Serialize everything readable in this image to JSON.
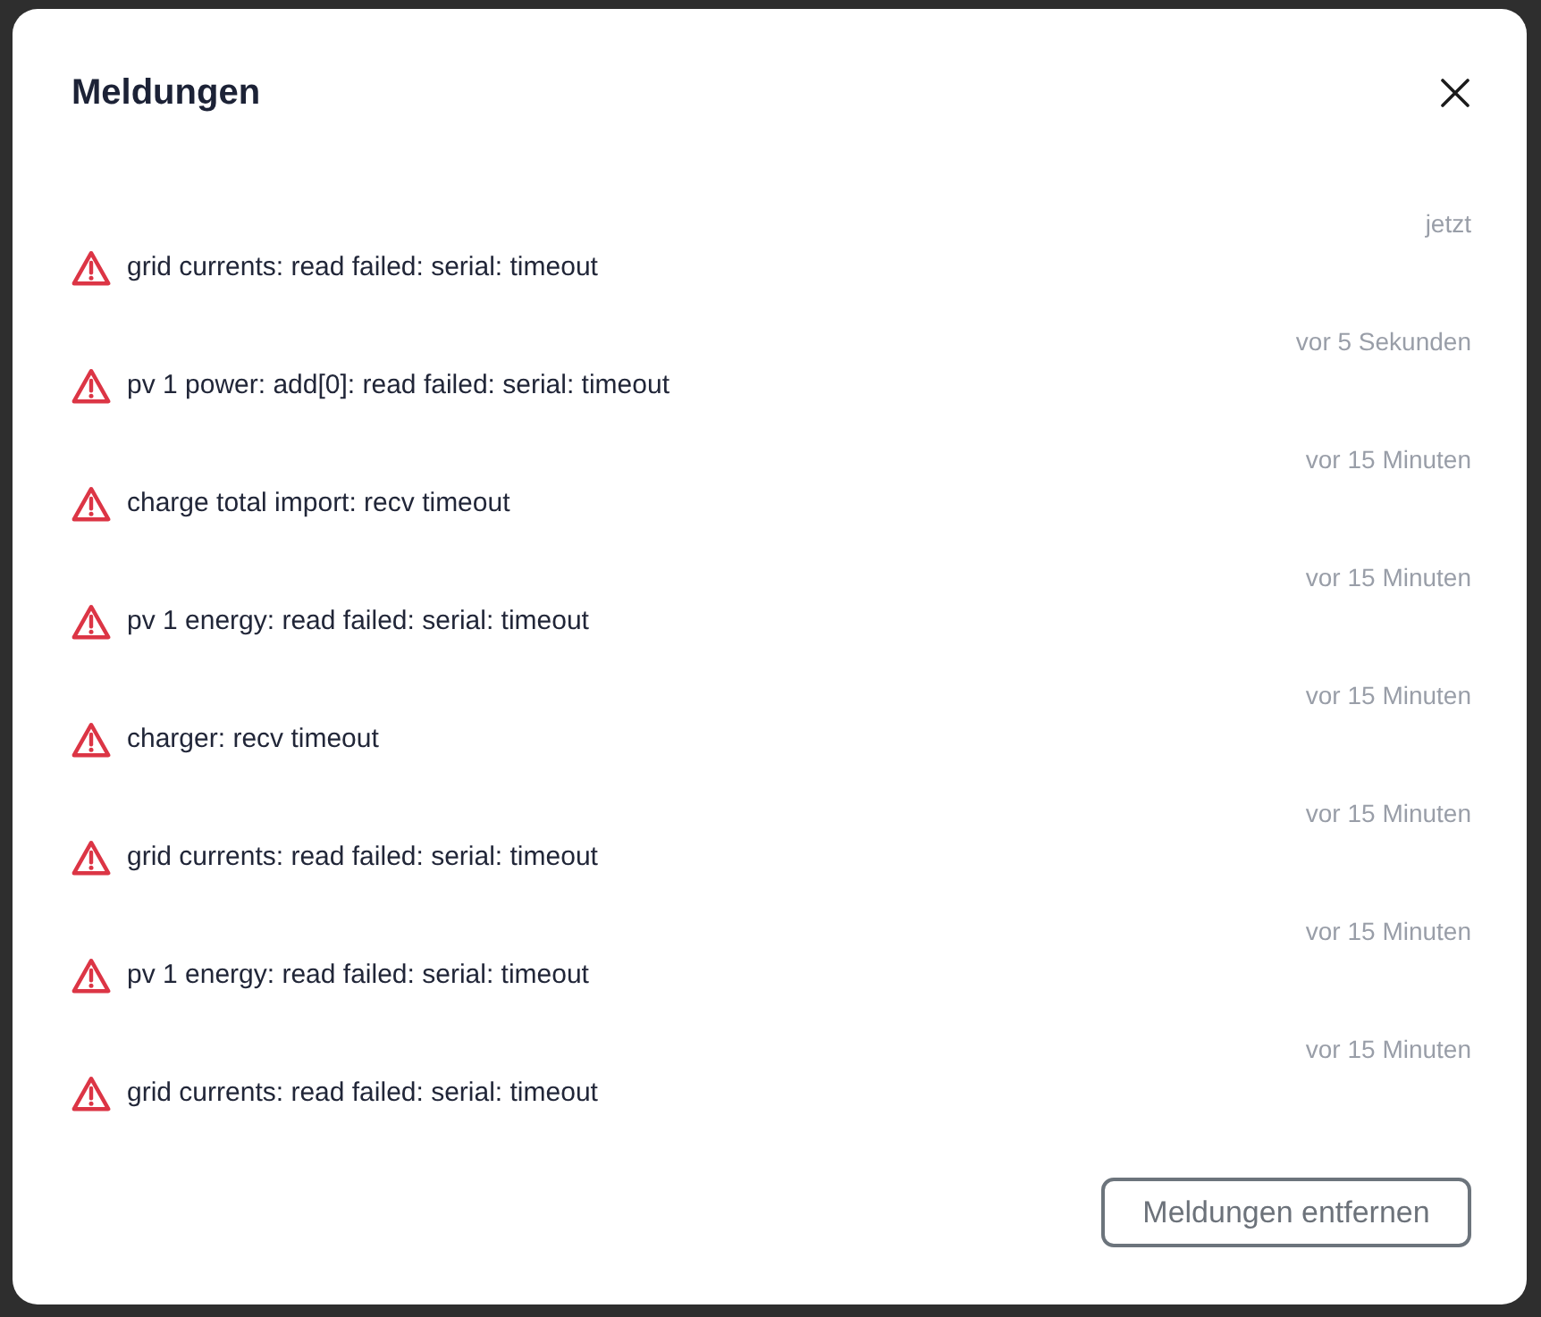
{
  "dialog": {
    "title": "Meldungen"
  },
  "messages": [
    {
      "time": "jetzt",
      "text": "grid currents: read failed: serial: timeout"
    },
    {
      "time": "vor 5 Sekunden",
      "text": "pv 1 power: add[0]: read failed: serial: timeout"
    },
    {
      "time": "vor 15 Minuten",
      "text": "charge total import: recv timeout"
    },
    {
      "time": "vor 15 Minuten",
      "text": "pv 1 energy: read failed: serial: timeout"
    },
    {
      "time": "vor 15 Minuten",
      "text": "charger: recv timeout"
    },
    {
      "time": "vor 15 Minuten",
      "text": "grid currents: read failed: serial: timeout"
    },
    {
      "time": "vor 15 Minuten",
      "text": "pv 1 energy: read failed: serial: timeout"
    },
    {
      "time": "vor 15 Minuten",
      "text": "grid currents: read failed: serial: timeout"
    }
  ],
  "footer": {
    "clear_button": "Meldungen entfernen"
  }
}
